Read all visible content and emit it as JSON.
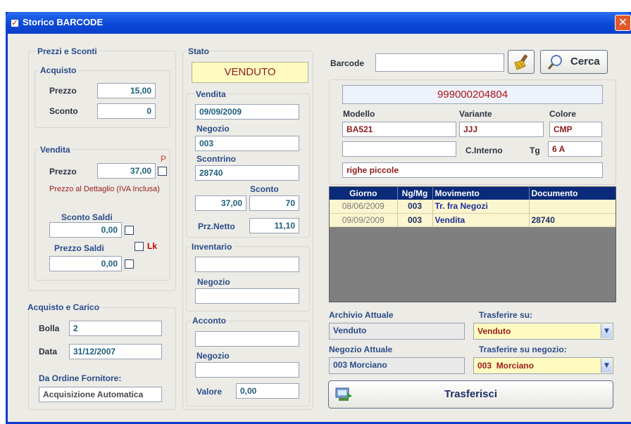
{
  "window": {
    "title": "Storico BARCODE",
    "close_glyph": "✕"
  },
  "prezzi_sconti": {
    "group_label": "Prezzi e Sconti",
    "acquisto": {
      "label": "Acquisto",
      "prezzo_label": "Prezzo",
      "prezzo_value": "15,00",
      "sconto_label": "Sconto",
      "sconto_value": "0"
    },
    "vendita": {
      "label": "Vendita",
      "prezzo_label": "Prezzo",
      "prezzo_value": "37,00",
      "p_marker": "P",
      "note": "Prezzo al Dettaglio (IVA Inclusa)",
      "sconto_saldi_label": "Sconto Saldi",
      "sconto_saldi_value": "0,00",
      "prezzo_saldi_label": "Prezzo Saldi",
      "prezzo_saldi_value": "0,00",
      "lk_label": "Lk"
    }
  },
  "acquisto_carico": {
    "group_label": "Acquisto e Carico",
    "bolla_label": "Bolla",
    "bolla_value": "2",
    "data_label": "Data",
    "data_value": "31/12/2007",
    "ordine_label": "Da Ordine Fornitore:",
    "ordine_value": "Acquisizione Automatica"
  },
  "stato": {
    "group_label": "Stato",
    "value": "VENDUTO",
    "vendita": {
      "label": "Vendita",
      "date": "09/09/2009",
      "negozio_label": "Negozio",
      "negozio_value": "003",
      "scontrino_label": "Scontrino",
      "scontrino_value": "28740",
      "sconto_label": "Sconto",
      "prezzo_value": "37,00",
      "sconto_value": "70",
      "prz_netto_label": "Prz.Netto",
      "prz_netto_value": "11,10"
    },
    "inventario": {
      "label": "Inventario",
      "value": "",
      "negozio_label": "Negozio",
      "negozio_value": ""
    },
    "acconto": {
      "label": "Acconto",
      "value": "",
      "negozio_label": "Negozio",
      "negozio_value": "",
      "valore_label": "Valore",
      "valore_value": "0,00"
    }
  },
  "barcode": {
    "label": "Barcode",
    "value": "",
    "clear_icon": "broom-icon",
    "search_label": "Cerca",
    "search_icon": "magnifier-icon"
  },
  "articolo": {
    "code": "999000204804",
    "modello_label": "Modello",
    "modello_value": "BA521",
    "variante_label": "Variante",
    "variante_value": "JJJ",
    "colore_label": "Colore",
    "colore_value": "CMP",
    "extra_value": "",
    "cinterno_label": "C.Interno",
    "tg_label": "Tg",
    "tg_value": "6 A",
    "descrizione": "righe piccole"
  },
  "movimenti": {
    "columns": [
      "Giorno",
      "Ng/Mg",
      "Movimento",
      "Documento"
    ],
    "rows": [
      {
        "giorno": "08/06/2009",
        "ngmg": "003",
        "movimento": "Tr. fra Negozi",
        "documento": ""
      },
      {
        "giorno": "09/09/2009",
        "ngmg": "003",
        "movimento": "Vendita",
        "documento": "28740"
      }
    ]
  },
  "trasferimento": {
    "archivio_label": "Archivio Attuale",
    "archivio_value": "Venduto",
    "trasferire_label": "Trasferire su:",
    "trasferire_value": "Venduto",
    "negozio_label": "Negozio Attuale",
    "negozio_value": "003  Morciano",
    "trasferire_negozio_label": "Trasferire su negozio:",
    "trasferire_negozio_value": "003  Morciano",
    "button_label": "Trasferisci"
  },
  "colors": {
    "accent": "#0a2a7a",
    "title_bar": "#0b48d8",
    "status_bg": "#fffbc0",
    "grid_bg": "#7f7f7f",
    "row_bg": "#fbf6cf"
  }
}
